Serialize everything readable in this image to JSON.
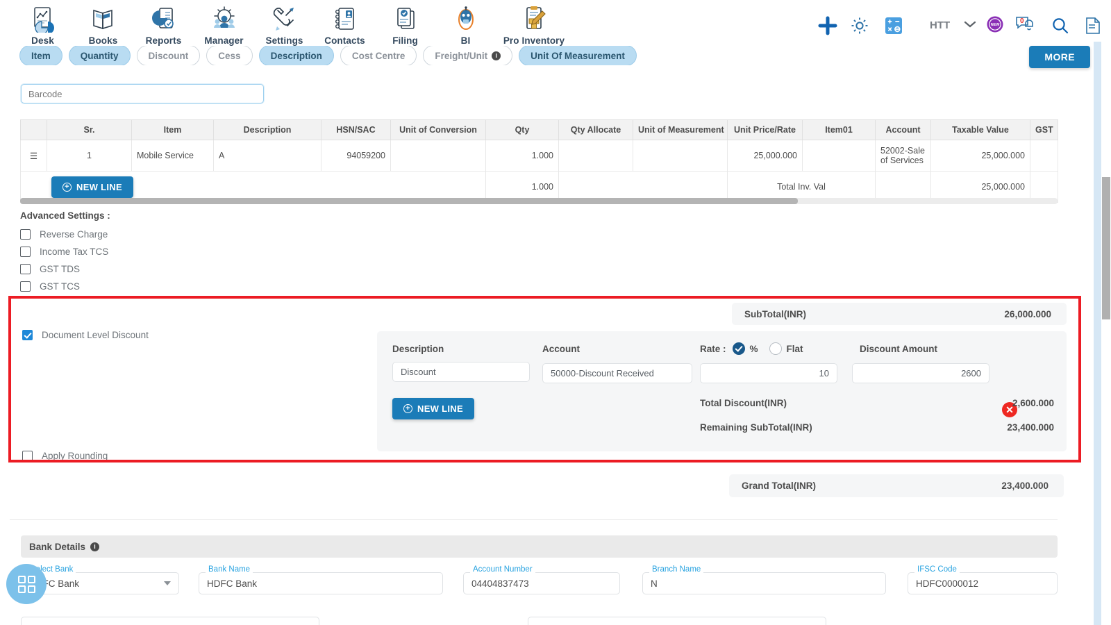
{
  "topnav": {
    "modules": [
      {
        "label": "Desk",
        "icon": "desk-chart-icon"
      },
      {
        "label": "Books",
        "icon": "books-icon"
      },
      {
        "label": "Reports",
        "icon": "reports-pie-icon"
      },
      {
        "label": "Manager",
        "icon": "manager-people-icon"
      },
      {
        "label": "Settings",
        "icon": "settings-tools-icon"
      },
      {
        "label": "Contacts",
        "icon": "contacts-book-icon"
      },
      {
        "label": "Filing",
        "icon": "filing-docs-icon"
      },
      {
        "label": "BI",
        "icon": "bi-robot-icon"
      },
      {
        "label": "Pro Inventory",
        "icon": "pro-inventory-icon"
      }
    ],
    "company": "HTT",
    "new_badge": "NEW",
    "notification_count": "0",
    "icons": [
      "plus-icon",
      "gear-icon",
      "calculator-icon",
      "chevron-down-icon",
      "new-badge-icon",
      "notification-bell-icon",
      "search-icon",
      "document-icon"
    ]
  },
  "chips": [
    {
      "label": "Item",
      "active": true,
      "info": false
    },
    {
      "label": "Quantity",
      "active": true,
      "info": false
    },
    {
      "label": "Discount",
      "active": false,
      "info": false
    },
    {
      "label": "Cess",
      "active": false,
      "info": false
    },
    {
      "label": "Description",
      "active": true,
      "info": false
    },
    {
      "label": "Cost Centre",
      "active": false,
      "info": false
    },
    {
      "label": "Freight/Unit",
      "active": false,
      "info": true
    },
    {
      "label": "Unit Of Measurement",
      "active": true,
      "info": false
    }
  ],
  "more_button": "MORE",
  "barcode": {
    "value": "",
    "placeholder": "Barcode"
  },
  "lines_table": {
    "columns": [
      "",
      "Sr.",
      "Item",
      "Description",
      "HSN/SAC",
      "Unit of Conversion",
      "Qty",
      "Qty Allocate",
      "Unit of Measurement",
      "Unit Price/Rate",
      "Item01",
      "Account",
      "Taxable Value",
      "GST"
    ],
    "rows": [
      {
        "sr": "1",
        "item": "Mobile Service",
        "description": "A",
        "hsn_sac": "94059200",
        "unit_of_conversion": "",
        "qty": "1.000",
        "qty_allocate": "",
        "unit_of_measurement": "",
        "unit_price_rate": "25,000.000",
        "item01": "",
        "account": "52002-Sale of Services",
        "taxable_value": "25,000.000",
        "gst": ""
      }
    ],
    "footer": {
      "new_line_label": "NEW LINE",
      "qty_total": "1.000",
      "total_label": "Total Inv. Val",
      "taxable_total": "25,000.000"
    }
  },
  "advanced_settings": {
    "title": "Advanced Settings :",
    "options": [
      {
        "label": "Reverse Charge",
        "checked": false
      },
      {
        "label": "Income Tax TCS",
        "checked": false
      },
      {
        "label": "GST TDS",
        "checked": false
      },
      {
        "label": "GST TCS",
        "checked": false
      }
    ]
  },
  "discount_section": {
    "subtotal_label": "SubTotal(INR)",
    "subtotal_value": "26,000.000",
    "document_level_discount_label": "Document Level Discount",
    "document_level_discount_checked": true,
    "apply_rounding_label": "Apply Rounding",
    "apply_rounding_checked": false,
    "col_description": "Description",
    "col_account": "Account",
    "rate_label": "Rate :",
    "rate_percent_label": "%",
    "rate_flat_label": "Flat",
    "rate_mode": "percent",
    "col_discount_amount": "Discount Amount",
    "row": {
      "description": "Discount",
      "account": "50000-Discount Received",
      "rate": "10",
      "discount_amount": "2600"
    },
    "new_line_label": "NEW LINE",
    "total_discount_label": "Total Discount(INR)",
    "total_discount_value": "2,600.000",
    "remaining_subtotal_label": "Remaining SubTotal(INR)",
    "remaining_subtotal_value": "23,400.000",
    "delete_icon": "delete-row-icon",
    "highlight_color": "#ec1c24"
  },
  "grand_total": {
    "label": "Grand Total(INR)",
    "value": "23,400.000"
  },
  "bank_details": {
    "title": "Bank Details",
    "info_icon": "info-icon",
    "fields": [
      {
        "label": "Select Bank",
        "value": "HDFC Bank",
        "type": "select"
      },
      {
        "label": "Bank Name",
        "value": "HDFC Bank",
        "type": "text"
      },
      {
        "label": "Account Number",
        "value": "04404837473",
        "type": "text"
      },
      {
        "label": "Branch Name",
        "value": "N",
        "type": "text"
      },
      {
        "label": "IFSC Code",
        "value": "HDFC0000012",
        "type": "text"
      }
    ]
  },
  "fab": {
    "icon": "apps-grid-icon"
  }
}
